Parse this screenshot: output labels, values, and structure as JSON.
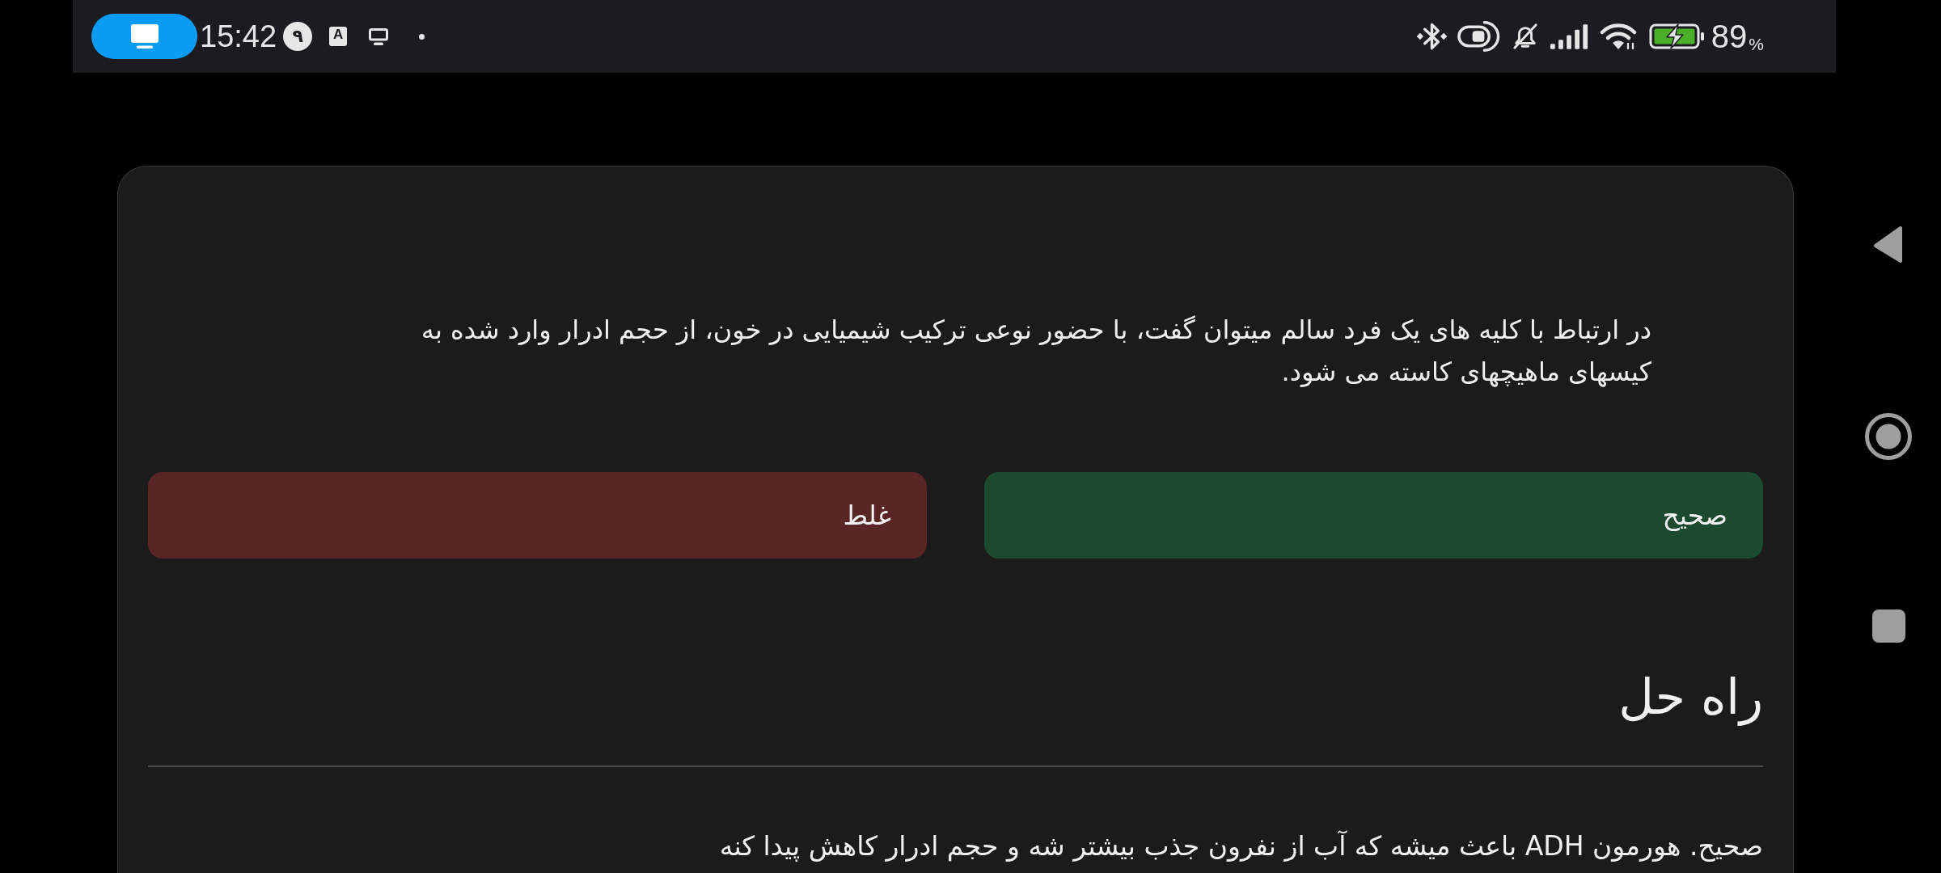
{
  "status_bar": {
    "time": "15:42",
    "notification_digit": "۹",
    "keyboard_letter": "A",
    "battery_percent": "89",
    "percent_sign": "%"
  },
  "card": {
    "question": "در ارتباط با کلیه های یک فرد سالم میتوان گفت، با حضور نوعی ترکیب شیمیایی در خون، از حجم ادرار وارد شده به کیسهای ماهیچهای کاسته می شود.",
    "answers": [
      {
        "label": "صحیح",
        "color": "#1c4a2e"
      },
      {
        "label": "غلط",
        "color": "#5a2525"
      }
    ],
    "solution_heading": "راه حل",
    "solution_text": "صحیح. هورمون ADH باعث میشه که آب از نفرون جذب بیشتر شه و حجم ادرار کاهش پیدا کنه"
  }
}
